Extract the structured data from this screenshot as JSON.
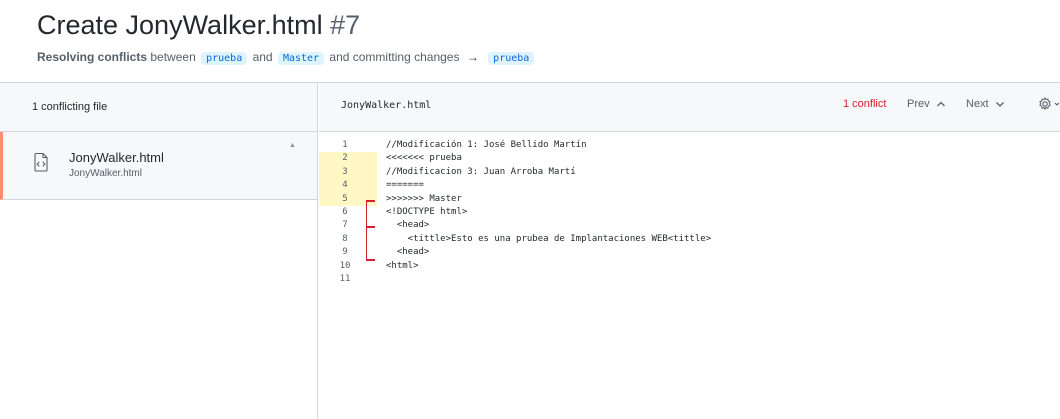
{
  "pr": {
    "title": "Create JonyWalker.html",
    "number": "#7",
    "subtitle_bold": "Resolving conflicts",
    "subtitle_between": "between",
    "branch_from": "prueba",
    "subtitle_and": "and",
    "branch_to": "Master",
    "subtitle_committing": "and committing changes",
    "arrow": "→",
    "branch_target": "prueba"
  },
  "sidebar": {
    "header": "1 conflicting file",
    "file": {
      "name": "JonyWalker.html",
      "path": "JonyWalker.html"
    }
  },
  "editor": {
    "filename": "JonyWalker.html",
    "conflict_count": "1 conflict",
    "prev_label": "Prev",
    "next_label": "Next",
    "lines": [
      {
        "n": "1",
        "text": "//Modificación 1: José Bellido Martín"
      },
      {
        "n": "2",
        "text": "<<<<<<< prueba"
      },
      {
        "n": "3",
        "text": "//Modificacion 3: Juan Arroba Martí"
      },
      {
        "n": "4",
        "text": "======="
      },
      {
        "n": "5",
        "text": ">>>>>>> Master"
      },
      {
        "n": "6",
        "text": "<!DOCTYPE html>"
      },
      {
        "n": "7",
        "text": "  <head>"
      },
      {
        "n": "8",
        "text": "    <tittle>Esto es una prubea de Implantaciones WEB<tittle>"
      },
      {
        "n": "9",
        "text": "  <head>"
      },
      {
        "n": "10",
        "text": "<html>"
      },
      {
        "n": "11",
        "text": ""
      }
    ]
  },
  "colors": {
    "conflict": "#cf222e",
    "highlight": "#fff8c5",
    "branch_bg": "#ddf4ff",
    "branch_fg": "#0969da",
    "selected_accent": "#fd8c73"
  }
}
